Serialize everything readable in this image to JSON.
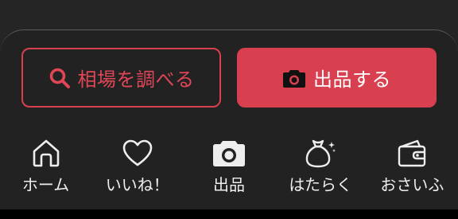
{
  "colors": {
    "background": "#222222",
    "accent": "#d8404f",
    "icon": "#eeeeee"
  },
  "actions": {
    "search_label": "相場を調べる",
    "search_icon": "search-icon",
    "sell_label": "出品する",
    "sell_icon": "camera-icon"
  },
  "nav": {
    "items": [
      {
        "label": "ホーム",
        "icon": "home-icon"
      },
      {
        "label": "いいね！",
        "icon": "heart-icon"
      },
      {
        "label": "出品",
        "icon": "camera-icon"
      },
      {
        "label": "はたらく",
        "icon": "money-bag-icon"
      },
      {
        "label": "おさいふ",
        "icon": "wallet-icon"
      }
    ]
  }
}
